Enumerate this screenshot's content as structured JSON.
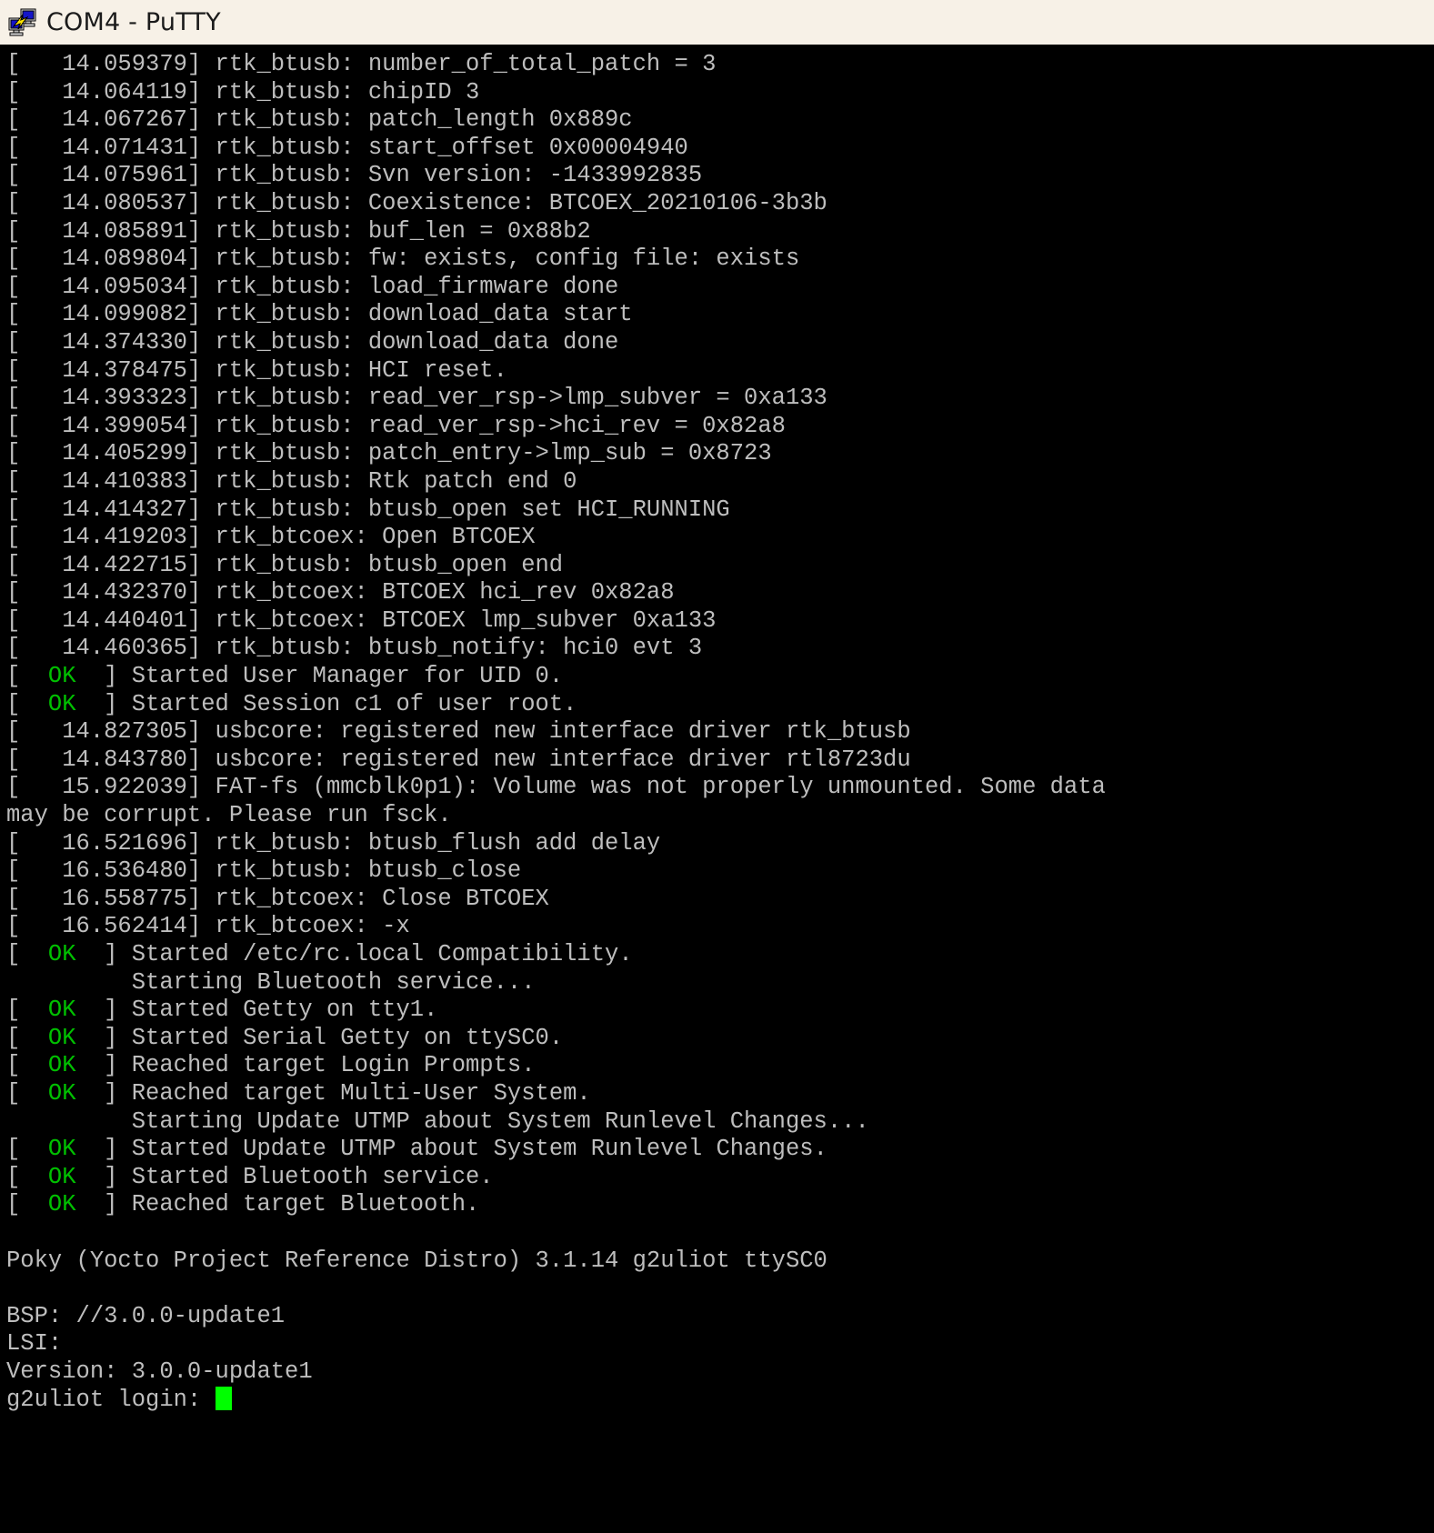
{
  "window": {
    "title": "COM4 - PuTTY",
    "icon": "putty-computer-lightning-icon",
    "titlebar_bg": "#f7f1e7",
    "titlebar_fg": "#1b1b1b"
  },
  "terminal": {
    "bg": "#000000",
    "fg": "#bebebe",
    "ok_color": "#00c000",
    "cursor_color": "#00ff00",
    "cursor_shape": "block",
    "columns": 73,
    "prompt_line": "g2uliot login: ",
    "lines": [
      {
        "text": "[   14.059379] rtk_btusb: number_of_total_patch = 3"
      },
      {
        "text": "[   14.064119] rtk_btusb: chipID 3"
      },
      {
        "text": "[   14.067267] rtk_btusb: patch_length 0x889c"
      },
      {
        "text": "[   14.071431] rtk_btusb: start_offset 0x00004940"
      },
      {
        "text": "[   14.075961] rtk_btusb: Svn version: -1433992835"
      },
      {
        "text": "[   14.080537] rtk_btusb: Coexistence: BTCOEX_20210106-3b3b"
      },
      {
        "text": "[   14.085891] rtk_btusb: buf_len = 0x88b2"
      },
      {
        "text": "[   14.089804] rtk_btusb: fw: exists, config file: exists"
      },
      {
        "text": "[   14.095034] rtk_btusb: load_firmware done"
      },
      {
        "text": "[   14.099082] rtk_btusb: download_data start"
      },
      {
        "text": "[   14.374330] rtk_btusb: download_data done"
      },
      {
        "text": "[   14.378475] rtk_btusb: HCI reset."
      },
      {
        "text": "[   14.393323] rtk_btusb: read_ver_rsp->lmp_subver = 0xa133"
      },
      {
        "text": "[   14.399054] rtk_btusb: read_ver_rsp->hci_rev = 0x82a8"
      },
      {
        "text": "[   14.405299] rtk_btusb: patch_entry->lmp_sub = 0x8723"
      },
      {
        "text": "[   14.410383] rtk_btusb: Rtk patch end 0"
      },
      {
        "text": "[   14.414327] rtk_btusb: btusb_open set HCI_RUNNING"
      },
      {
        "text": "[   14.419203] rtk_btcoex: Open BTCOEX"
      },
      {
        "text": "[   14.422715] rtk_btusb: btusb_open end"
      },
      {
        "text": "[   14.432370] rtk_btcoex: BTCOEX hci_rev 0x82a8"
      },
      {
        "text": "[   14.440401] rtk_btcoex: BTCOEX lmp_subver 0xa133"
      },
      {
        "text": "[   14.460365] rtk_btusb: btusb_notify: hci0 evt 3"
      },
      {
        "prefix": "[  ",
        "ok": "OK",
        "suffix": "  ] Started User Manager for UID 0."
      },
      {
        "prefix": "[  ",
        "ok": "OK",
        "suffix": "  ] Started Session c1 of user root."
      },
      {
        "text": "[   14.827305] usbcore: registered new interface driver rtk_btusb"
      },
      {
        "text": "[   14.843780] usbcore: registered new interface driver rtl8723du"
      },
      {
        "text": "[   15.922039] FAT-fs (mmcblk0p1): Volume was not properly unmounted. Some data"
      },
      {
        "text": "may be corrupt. Please run fsck."
      },
      {
        "text": "[   16.521696] rtk_btusb: btusb_flush add delay"
      },
      {
        "text": "[   16.536480] rtk_btusb: btusb_close"
      },
      {
        "text": "[   16.558775] rtk_btcoex: Close BTCOEX"
      },
      {
        "text": "[   16.562414] rtk_btcoex: -x"
      },
      {
        "prefix": "[  ",
        "ok": "OK",
        "suffix": "  ] Started /etc/rc.local Compatibility."
      },
      {
        "text": "         Starting Bluetooth service..."
      },
      {
        "prefix": "[  ",
        "ok": "OK",
        "suffix": "  ] Started Getty on tty1."
      },
      {
        "prefix": "[  ",
        "ok": "OK",
        "suffix": "  ] Started Serial Getty on ttySC0."
      },
      {
        "prefix": "[  ",
        "ok": "OK",
        "suffix": "  ] Reached target Login Prompts."
      },
      {
        "prefix": "[  ",
        "ok": "OK",
        "suffix": "  ] Reached target Multi-User System."
      },
      {
        "text": "         Starting Update UTMP about System Runlevel Changes..."
      },
      {
        "prefix": "[  ",
        "ok": "OK",
        "suffix": "  ] Started Update UTMP about System Runlevel Changes."
      },
      {
        "prefix": "[  ",
        "ok": "OK",
        "suffix": "  ] Started Bluetooth service."
      },
      {
        "prefix": "[  ",
        "ok": "OK",
        "suffix": "  ] Reached target Bluetooth."
      },
      {
        "text": ""
      },
      {
        "text": "Poky (Yocto Project Reference Distro) 3.1.14 g2uliot ttySC0"
      },
      {
        "text": ""
      },
      {
        "text": "BSP: //3.0.0-update1"
      },
      {
        "text": "LSI:"
      },
      {
        "text": "Version: 3.0.0-update1"
      },
      {
        "text": "",
        "prompt": true
      }
    ]
  }
}
